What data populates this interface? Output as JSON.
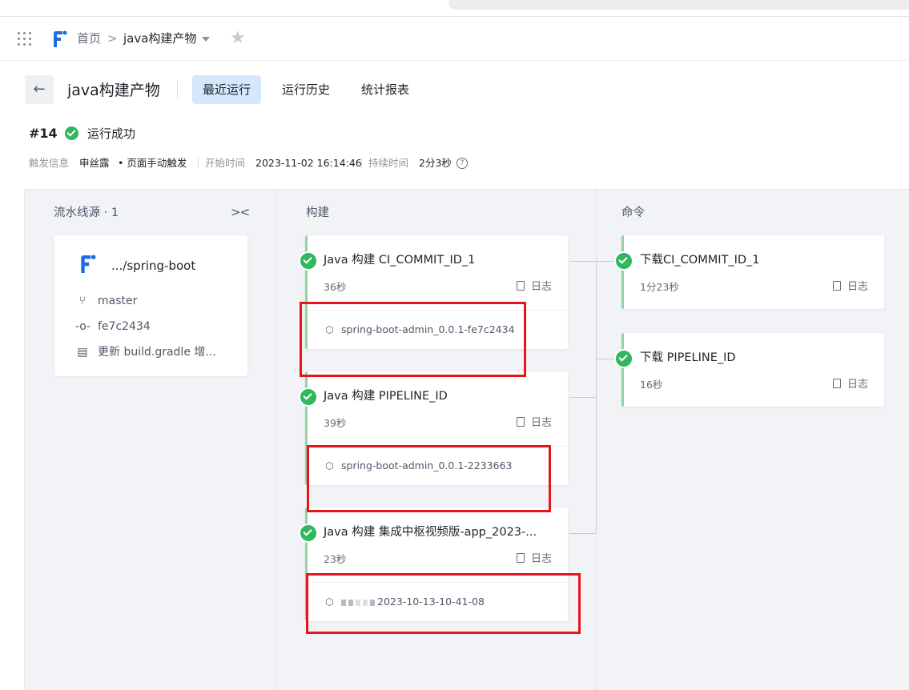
{
  "breadcrumb": {
    "home": "首页",
    "separator": ">",
    "current": "java构建产物"
  },
  "header": {
    "back_icon": "arrow-left-icon",
    "title": "java构建产物",
    "tabs": [
      {
        "label": "最近运行",
        "active": true
      },
      {
        "label": "运行历史",
        "active": false
      },
      {
        "label": "统计报表",
        "active": false
      }
    ]
  },
  "run": {
    "number": "#14",
    "status": "运行成功",
    "trigger_label": "触发信息",
    "trigger_user": "申丝露",
    "trigger_method": "• 页面手动触发",
    "start_label": "开始时间",
    "start_time": "2023-11-02 16:14:46",
    "duration_label": "持续时间",
    "duration": "2分3秒",
    "help_icon": "question-circle-icon"
  },
  "source": {
    "header": "流水线源 · 1",
    "collapse_icon": "collapse-icon",
    "repo": ".../spring-boot",
    "branch": "master",
    "commit": "fe7c2434",
    "message": "更新 build.gradle 增..."
  },
  "stages": [
    {
      "name": "构建",
      "jobs": [
        {
          "title": "Java 构建 CI_COMMIT_ID_1",
          "duration": "36秒",
          "log": "日志",
          "artifact": "spring-boot-admin_0.0.1-fe7c2434"
        },
        {
          "title": "Java 构建 PIPELINE_ID",
          "duration": "39秒",
          "log": "日志",
          "artifact": "spring-boot-admin_0.0.1-2233663"
        },
        {
          "title": "Java 构建 集成中枢视频版-app_2023-...",
          "duration": "23秒",
          "log": "日志",
          "artifact": "2023-10-13-10-41-08"
        }
      ]
    },
    {
      "name": "命令",
      "jobs": [
        {
          "title": "下载CI_COMMIT_ID_1",
          "duration": "1分23秒",
          "log": "日志"
        },
        {
          "title": "下载 PIPELINE_ID",
          "duration": "16秒",
          "log": "日志"
        }
      ]
    }
  ],
  "colors": {
    "success": "#2fb85d",
    "active_tab": "#d5e8fb",
    "highlight_box": "#e8141c"
  }
}
